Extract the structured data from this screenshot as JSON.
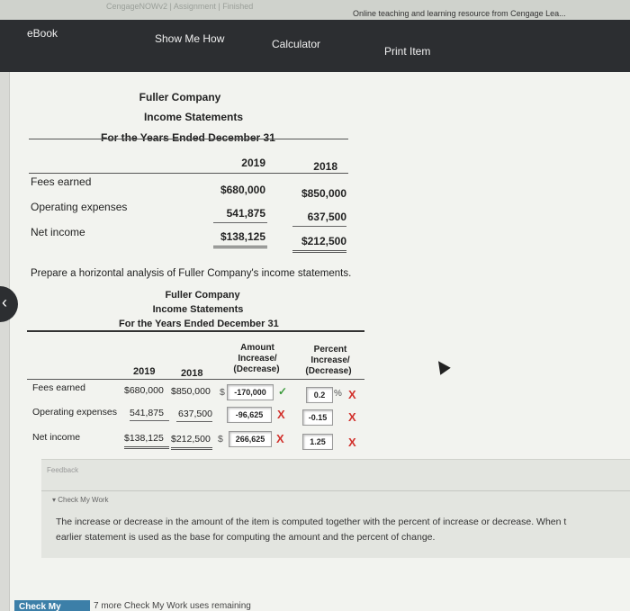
{
  "browser": {
    "breadcrumbs": "CengageNOWv2 | Assignment | Finished",
    "tab_title": "Online teaching and learning resource from Cengage Lea..."
  },
  "toolbar": {
    "ebook": "eBook",
    "show_me_how": "Show Me How",
    "calculator": "Calculator",
    "print_item": "Print Item"
  },
  "statement1": {
    "company": "Fuller Company",
    "title": "Income Statements",
    "period": "For the Years Ended December 31",
    "year1": "2019",
    "year2": "2018",
    "rows": [
      {
        "label": "Fees earned",
        "v2019": "$680,000",
        "v2018": "$850,000"
      },
      {
        "label": "Operating expenses",
        "v2019": "541,875",
        "v2018": "637,500"
      },
      {
        "label": "Net income",
        "v2019": "$138,125",
        "v2018": "$212,500"
      }
    ]
  },
  "instructions": "Prepare a horizontal analysis of Fuller Company's income statements.",
  "statement2": {
    "company": "Fuller Company",
    "title": "Income Statements",
    "period": "For the Years Ended December 31",
    "headers": {
      "year1": "2019",
      "year2": "2018",
      "amount_line1": "Amount",
      "amount_line2": "Increase/",
      "amount_line3": "(Decrease)",
      "percent_line1": "Percent",
      "percent_line2": "Increase/",
      "percent_line3": "(Decrease)"
    },
    "rows": [
      {
        "label": "Fees earned",
        "v2019": "$680,000",
        "v2018": "$850,000",
        "currency": "$",
        "amount": "-170,000",
        "amount_status": "correct",
        "percent": "0.2",
        "percent_sign": "%",
        "percent_status": "incorrect"
      },
      {
        "label": "Operating expenses",
        "v2019": "541,875",
        "v2018": "637,500",
        "currency": "",
        "amount": "-96,625",
        "amount_status": "incorrect",
        "percent": "-0.15",
        "percent_sign": "",
        "percent_status": "incorrect"
      },
      {
        "label": "Net income",
        "v2019": "$138,125",
        "v2018": "$212,500",
        "currency": "$",
        "amount": "266,625",
        "amount_status": "incorrect",
        "percent": "1.25",
        "percent_sign": "",
        "percent_status": "incorrect"
      }
    ]
  },
  "feedback": {
    "label": "Feedback",
    "toggle": "Check My Work",
    "text_line1": "The increase or decrease in the amount of the item is computed together with the percent of increase or decrease. When t",
    "text_line2": "earlier statement is used as the base for computing the amount and the percent of change."
  },
  "footer": {
    "check_button": "Check My Work",
    "remaining": "7 more Check My Work uses remaining"
  },
  "marks": {
    "correct": "✓",
    "incorrect": "X"
  },
  "colors": {
    "toolbar": "#2c2e31",
    "correct": "#3a9a3a",
    "incorrect": "#d2322d",
    "button": "#3c7fa8"
  }
}
